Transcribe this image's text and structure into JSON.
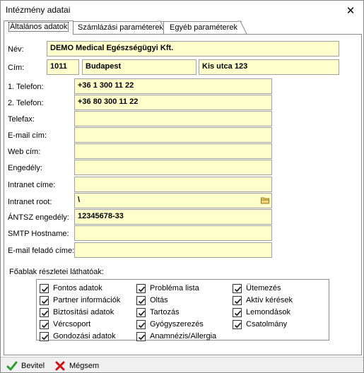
{
  "window": {
    "title": "Intézmény adatai"
  },
  "tabs": [
    {
      "label": "Általános adatok",
      "active": true
    },
    {
      "label": "Számlázási paraméterek",
      "active": false
    },
    {
      "label": "Egyéb paraméterek",
      "active": false
    }
  ],
  "form": {
    "nev": {
      "label": "Név:",
      "value": "DEMO Medical Egészségügyi Kft."
    },
    "cim": {
      "label": "Cím:",
      "zip": "1011",
      "city": "Budapest",
      "street": "Kis utca 123"
    },
    "telefon1": {
      "label": "1. Telefon:",
      "value": "+36 1  300 11 22"
    },
    "telefon2": {
      "label": "2. Telefon:",
      "value": "+36 80  300 11 22"
    },
    "telefax": {
      "label": "Telefax:",
      "value": ""
    },
    "email": {
      "label": "E-mail cím:",
      "value": ""
    },
    "web": {
      "label": "Web cím:",
      "value": ""
    },
    "engedely": {
      "label": "Engedély:",
      "value": ""
    },
    "intranet_cime": {
      "label": "Intranet címe:",
      "value": ""
    },
    "intranet_root": {
      "label": "Intranet root:",
      "value": "\\"
    },
    "antsz": {
      "label": "ÁNTSZ engedély:",
      "value": "12345678-33"
    },
    "smtp": {
      "label": "SMTP Hostname:",
      "value": ""
    },
    "email_felado": {
      "label": "E-mail feladó címe:",
      "value": ""
    }
  },
  "visible_sections": {
    "label": "Főablak részletei láthatóak:",
    "columns": [
      [
        "Fontos adatok",
        "Partner információk",
        "Biztosítási adatok",
        "Vércsoport",
        "Gondozási adatok"
      ],
      [
        "Probléma lista",
        "Oltás",
        "Tartozás",
        "Gyógyszerezés",
        "Anamnézis/Allergia"
      ],
      [
        "Ütemezés",
        "Aktív kérések",
        "Lemondások",
        "Csatolmány"
      ]
    ],
    "all_checked": true
  },
  "footer": {
    "ok_label": "Bevitel",
    "cancel_label": "Mégsem"
  },
  "colors": {
    "field_bg": "#ffffcc",
    "ok_icon": "#2e9b2e",
    "cancel_icon": "#d01010"
  },
  "icons": {
    "close": "close-icon",
    "folder": "folder-icon",
    "ok": "checkmark-icon",
    "cancel": "x-icon"
  }
}
